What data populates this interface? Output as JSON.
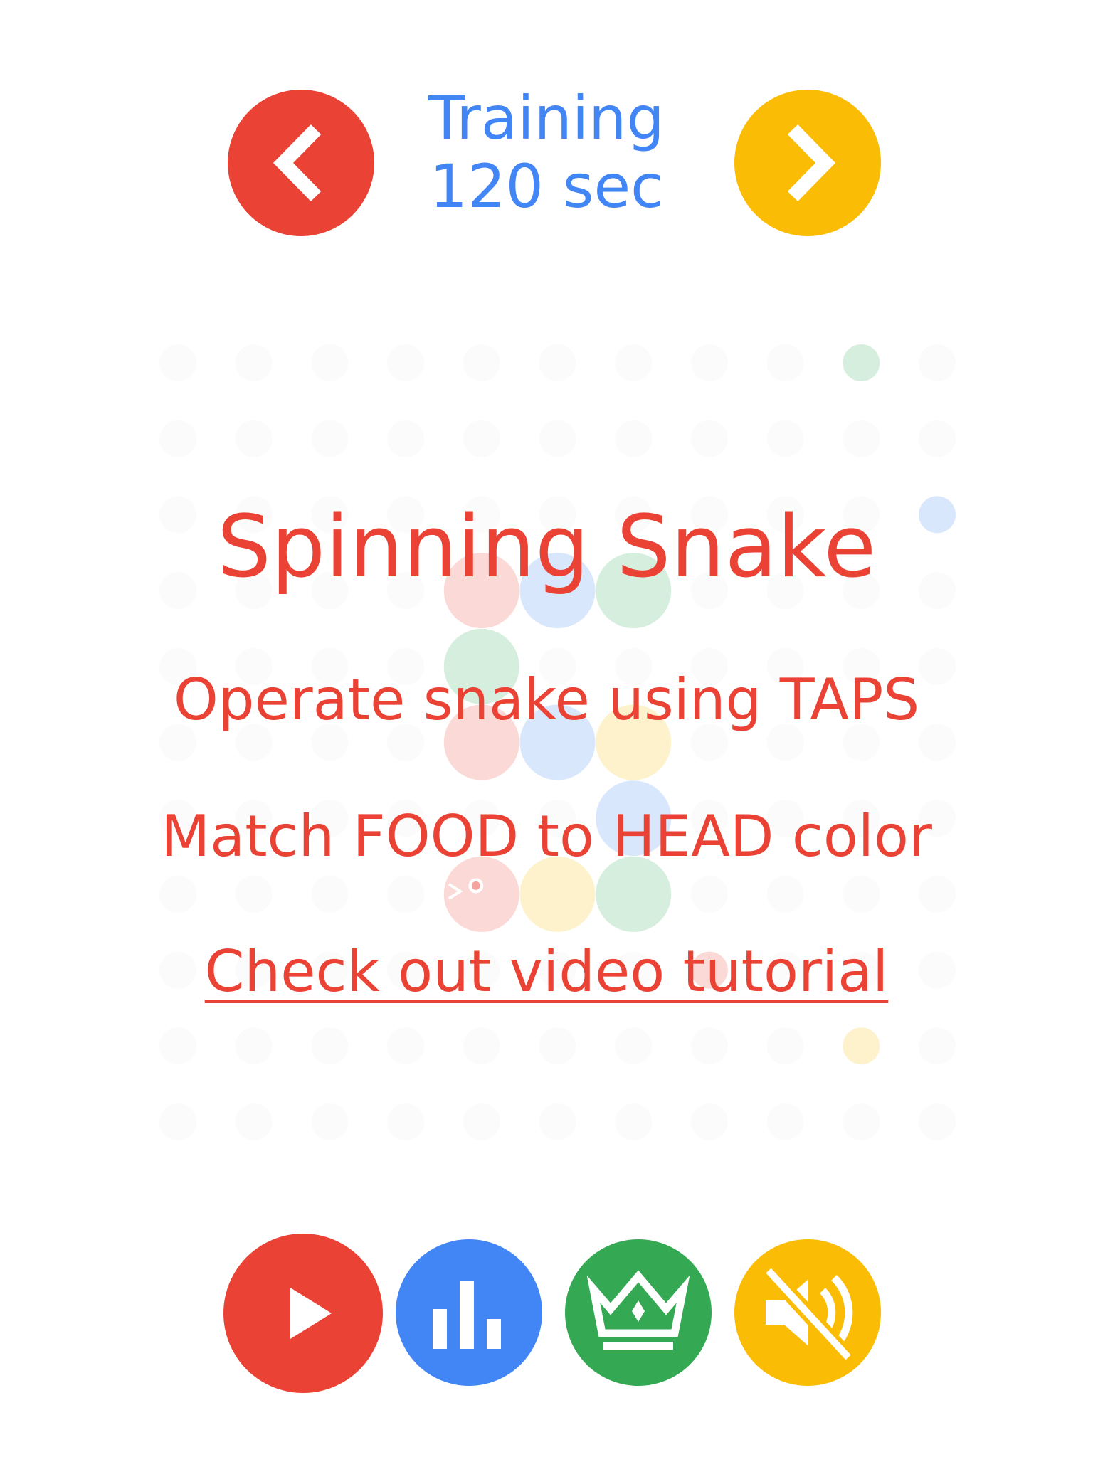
{
  "header": {
    "prev_label": "previous",
    "mode_line1": "Training",
    "mode_line2": "120 sec",
    "next_label": "next"
  },
  "game": {
    "title": "Spinning Snake",
    "instruction1": "Operate snake using TAPS",
    "instruction2": "Match FOOD to HEAD color",
    "tutorial_link": "Check out video tutorial"
  },
  "board": {
    "columns": 11,
    "rows": 11,
    "empty_cell_color": "#fbfbfb",
    "snake_cells": [
      {
        "col": 4,
        "row": 3,
        "color": "red"
      },
      {
        "col": 5,
        "row": 3,
        "color": "blue"
      },
      {
        "col": 6,
        "row": 3,
        "color": "green"
      },
      {
        "col": 4,
        "row": 4,
        "color": "green"
      },
      {
        "col": 4,
        "row": 5,
        "color": "red"
      },
      {
        "col": 5,
        "row": 5,
        "color": "blue"
      },
      {
        "col": 6,
        "row": 5,
        "color": "yellow"
      },
      {
        "col": 6,
        "row": 6,
        "color": "blue"
      },
      {
        "col": 4,
        "row": 7,
        "color": "red",
        "head": true
      },
      {
        "col": 5,
        "row": 7,
        "color": "yellow"
      },
      {
        "col": 6,
        "row": 7,
        "color": "green"
      }
    ],
    "food": [
      {
        "col": 9,
        "row": 0,
        "color": "green"
      },
      {
        "col": 10,
        "row": 2,
        "color": "blue"
      },
      {
        "col": 7,
        "row": 8,
        "color": "red"
      },
      {
        "col": 9,
        "row": 9,
        "color": "yellow"
      }
    ]
  },
  "footer": {
    "play_icon": "play-icon",
    "stats_icon": "bar-chart-icon",
    "leaderboard_icon": "crown-icon",
    "sound_icon": "speaker-muted-icon"
  },
  "colors": {
    "red": "#ea4335",
    "blue": "#4285f4",
    "green": "#34a853",
    "yellow": "#fbbc05",
    "red_light": "#fbd9d6",
    "blue_light": "#d9e7fd",
    "green_light": "#d6eedd",
    "yellow_light": "#fef2cd"
  }
}
